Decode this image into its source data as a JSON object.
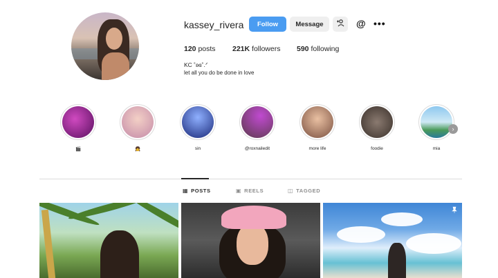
{
  "profile": {
    "username": "kassey_rivera",
    "follow_label": "Follow",
    "message_label": "Message",
    "add_user_icon": "add-user-icon",
    "threads_icon": "@",
    "more_icon": "•••",
    "posts_count": "120",
    "posts_label": "posts",
    "followers_count": "221K",
    "followers_label": "followers",
    "following_count": "590",
    "following_label": "following",
    "bio_name": "KC ˚ʚɞ˚.ᐟ",
    "bio_text": "let all you do be done in love"
  },
  "highlights": [
    {
      "label": "🎬",
      "color": "#8c2a8a"
    },
    {
      "label": "👧",
      "color": "#e7b7a6"
    },
    {
      "label": "sin",
      "color": "#2a3a9a"
    },
    {
      "label": "@roxnailedit",
      "color": "#7a4a6a"
    },
    {
      "label": "more life",
      "color": "#c89070"
    },
    {
      "label": "foodie",
      "color": "#6a5a52"
    },
    {
      "label": "mia",
      "color": "#6fb3d6"
    }
  ],
  "highlights_next_icon": "›",
  "tabs": {
    "posts": {
      "label": "POSTS",
      "icon": "▦"
    },
    "reels": {
      "label": "REELS",
      "icon": "▣"
    },
    "tagged": {
      "label": "TAGGED",
      "icon": "◫"
    }
  },
  "colors": {
    "accent": "#4a9cf1",
    "secondary_button": "#efefef",
    "divider": "#dbdbdb"
  }
}
